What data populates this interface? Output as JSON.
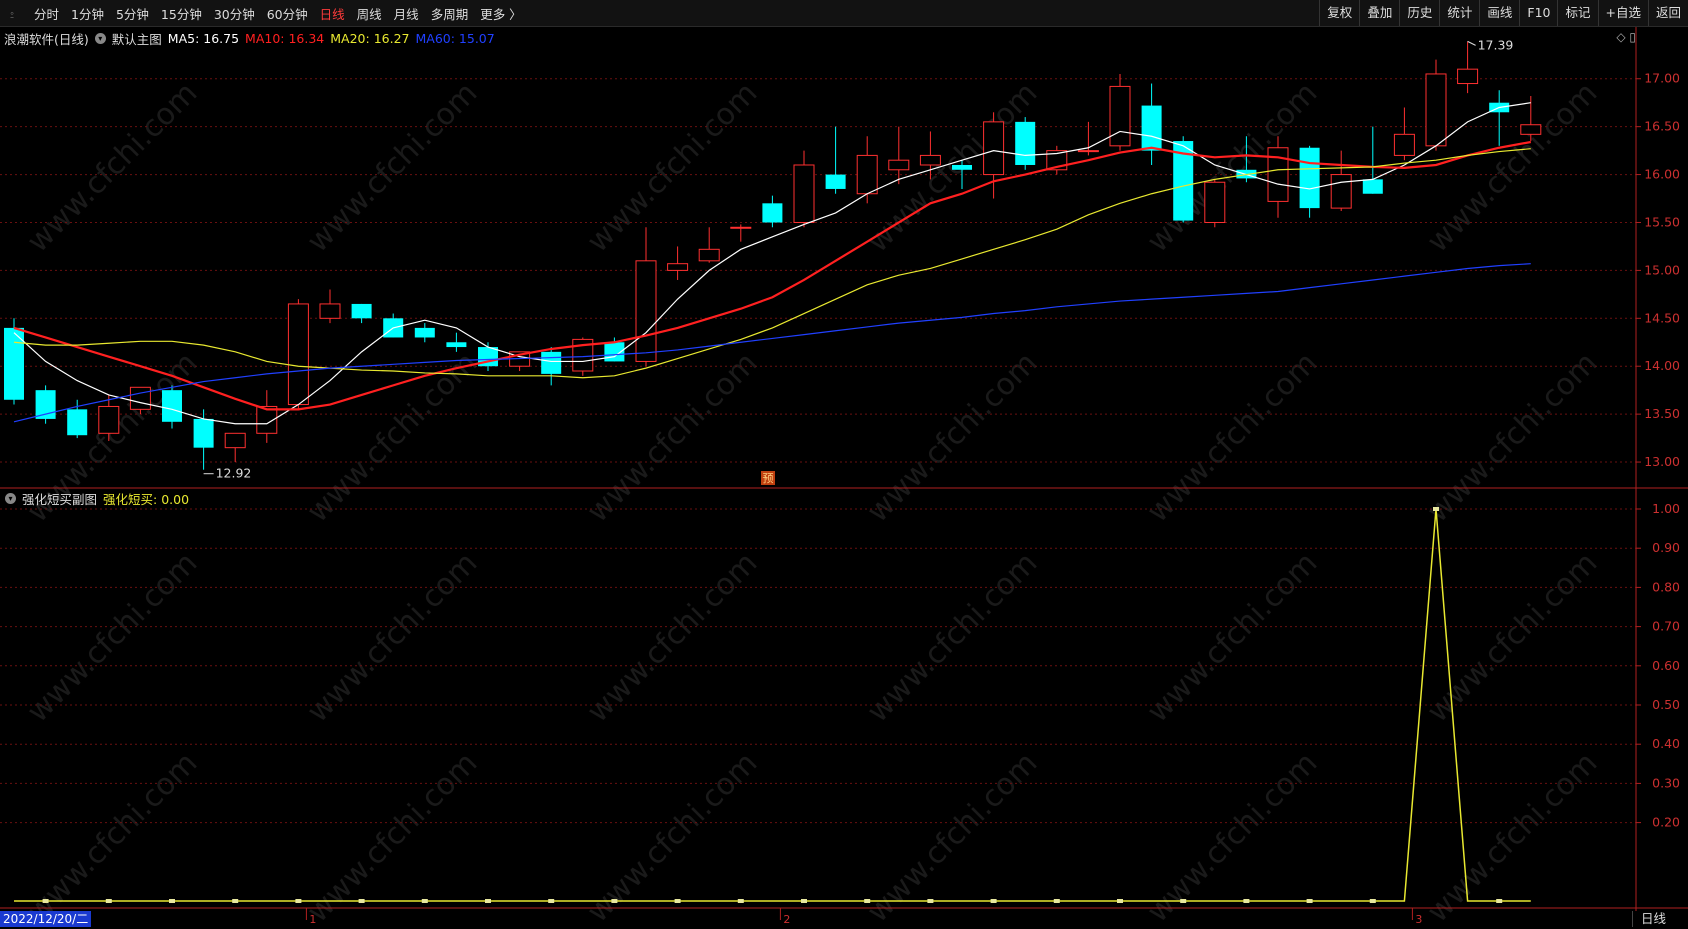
{
  "toolbar": {
    "left_icon": "⍛",
    "periods": [
      "分时",
      "1分钟",
      "5分钟",
      "15分钟",
      "30分钟",
      "60分钟",
      "日线",
      "周线",
      "月线",
      "多周期",
      "更多 〉"
    ],
    "active_period": "日线",
    "right_tools": [
      "复权",
      "叠加",
      "历史",
      "统计",
      "画线",
      "F10",
      "标记",
      "+自选",
      "返回"
    ]
  },
  "main_info": {
    "stock": "浪潮软件(日线)",
    "template": "默认主图",
    "ma5": "MA5: 16.75",
    "ma10": "MA10: 16.34",
    "ma20": "MA20: 16.27",
    "ma60": "MA60: 15.07",
    "ma5_color": "#ffffff",
    "ma10_color": "#ff2020",
    "ma20_color": "#e8e830",
    "ma60_color": "#2040ff"
  },
  "sub_info": {
    "title": "强化短买副图",
    "value": "强化短买: 0.00"
  },
  "markers": {
    "high": "17.39",
    "low": "12.92",
    "yu": "预"
  },
  "status": {
    "date": "2022/12/20/二",
    "mode": "日线",
    "month_ticks": [
      "1",
      "2",
      "3"
    ]
  },
  "watermark": "www.cfchi.com",
  "chart_data": [
    {
      "type": "candlestick",
      "title": "浪潮软件(日线)",
      "yticks": [
        13.0,
        13.5,
        14.0,
        14.5,
        15.0,
        15.5,
        16.0,
        16.5,
        17.0
      ],
      "ylim": [
        12.75,
        17.3
      ],
      "up_color": "#ff3030",
      "down_color": "#00ffff",
      "candles": [
        {
          "o": 14.4,
          "h": 14.5,
          "l": 13.6,
          "c": 13.65
        },
        {
          "o": 13.75,
          "h": 13.8,
          "l": 13.4,
          "c": 13.45
        },
        {
          "o": 13.55,
          "h": 13.65,
          "l": 13.25,
          "c": 13.28
        },
        {
          "o": 13.3,
          "h": 13.7,
          "l": 13.22,
          "c": 13.58
        },
        {
          "o": 13.55,
          "h": 13.78,
          "l": 13.5,
          "c": 13.78
        },
        {
          "o": 13.75,
          "h": 13.8,
          "l": 13.35,
          "c": 13.42
        },
        {
          "o": 13.45,
          "h": 13.55,
          "l": 12.92,
          "c": 13.15
        },
        {
          "o": 13.15,
          "h": 13.3,
          "l": 13.0,
          "c": 13.3
        },
        {
          "o": 13.3,
          "h": 13.75,
          "l": 13.2,
          "c": 13.58
        },
        {
          "o": 13.6,
          "h": 14.7,
          "l": 13.55,
          "c": 14.65
        },
        {
          "o": 14.5,
          "h": 14.8,
          "l": 14.45,
          "c": 14.65
        },
        {
          "o": 14.65,
          "h": 14.65,
          "l": 14.45,
          "c": 14.5
        },
        {
          "o": 14.5,
          "h": 14.55,
          "l": 14.3,
          "c": 14.3
        },
        {
          "o": 14.4,
          "h": 14.45,
          "l": 14.25,
          "c": 14.3
        },
        {
          "o": 14.25,
          "h": 14.35,
          "l": 14.15,
          "c": 14.2
        },
        {
          "o": 14.2,
          "h": 14.25,
          "l": 13.95,
          "c": 14.0
        },
        {
          "o": 14.0,
          "h": 14.1,
          "l": 13.95,
          "c": 14.15
        },
        {
          "o": 14.15,
          "h": 14.2,
          "l": 13.8,
          "c": 13.92
        },
        {
          "o": 13.95,
          "h": 14.3,
          "l": 13.9,
          "c": 14.28
        },
        {
          "o": 14.25,
          "h": 14.3,
          "l": 14.05,
          "c": 14.05
        },
        {
          "o": 14.05,
          "h": 15.45,
          "l": 14.0,
          "c": 15.1
        },
        {
          "o": 15.0,
          "h": 15.25,
          "l": 14.9,
          "c": 15.07
        },
        {
          "o": 15.1,
          "h": 15.45,
          "l": 15.08,
          "c": 15.22
        },
        {
          "o": 15.45,
          "h": 15.48,
          "l": 15.3,
          "c": 15.45
        },
        {
          "o": 15.7,
          "h": 15.78,
          "l": 15.45,
          "c": 15.5
        },
        {
          "o": 15.5,
          "h": 16.25,
          "l": 15.45,
          "c": 16.1
        },
        {
          "o": 16.0,
          "h": 16.5,
          "l": 15.8,
          "c": 15.85
        },
        {
          "o": 15.8,
          "h": 16.4,
          "l": 15.7,
          "c": 16.2
        },
        {
          "o": 16.05,
          "h": 16.5,
          "l": 15.9,
          "c": 16.15
        },
        {
          "o": 16.1,
          "h": 16.45,
          "l": 15.95,
          "c": 16.2
        },
        {
          "o": 16.1,
          "h": 16.15,
          "l": 15.85,
          "c": 16.05
        },
        {
          "o": 16.0,
          "h": 16.65,
          "l": 15.75,
          "c": 16.55
        },
        {
          "o": 16.55,
          "h": 16.6,
          "l": 16.05,
          "c": 16.1
        },
        {
          "o": 16.05,
          "h": 16.3,
          "l": 16.0,
          "c": 16.25
        },
        {
          "o": 16.25,
          "h": 16.55,
          "l": 16.2,
          "c": 16.25
        },
        {
          "o": 16.3,
          "h": 17.05,
          "l": 16.25,
          "c": 16.92
        },
        {
          "o": 16.72,
          "h": 16.95,
          "l": 16.1,
          "c": 16.25
        },
        {
          "o": 16.35,
          "h": 16.4,
          "l": 15.5,
          "c": 15.52
        },
        {
          "o": 15.5,
          "h": 15.95,
          "l": 15.45,
          "c": 15.92
        },
        {
          "o": 16.05,
          "h": 16.4,
          "l": 15.92,
          "c": 15.96
        },
        {
          "o": 15.72,
          "h": 16.4,
          "l": 15.55,
          "c": 16.28
        },
        {
          "o": 16.28,
          "h": 16.3,
          "l": 15.55,
          "c": 15.65
        },
        {
          "o": 15.65,
          "h": 16.25,
          "l": 15.62,
          "c": 16.0
        },
        {
          "o": 15.95,
          "h": 16.5,
          "l": 15.8,
          "c": 15.8
        },
        {
          "o": 16.2,
          "h": 16.7,
          "l": 16.15,
          "c": 16.42
        },
        {
          "o": 16.3,
          "h": 17.2,
          "l": 16.25,
          "c": 17.05
        },
        {
          "o": 16.95,
          "h": 17.39,
          "l": 16.85,
          "c": 17.1
        },
        {
          "o": 16.75,
          "h": 16.88,
          "l": 16.3,
          "c": 16.65
        },
        {
          "o": 16.42,
          "h": 16.82,
          "l": 16.35,
          "c": 16.52
        }
      ],
      "series": [
        {
          "name": "MA5",
          "color": "#ffffff",
          "values": [
            14.35,
            14.05,
            13.85,
            13.7,
            13.62,
            13.55,
            13.45,
            13.4,
            13.4,
            13.6,
            13.85,
            14.15,
            14.4,
            14.48,
            14.4,
            14.2,
            14.1,
            14.05,
            14.05,
            14.1,
            14.35,
            14.7,
            15.0,
            15.22,
            15.35,
            15.48,
            15.6,
            15.8,
            15.95,
            16.05,
            16.15,
            16.25,
            16.2,
            16.22,
            16.28,
            16.45,
            16.4,
            16.3,
            16.1,
            16.0,
            15.9,
            15.85,
            15.92,
            15.95,
            16.1,
            16.3,
            16.55,
            16.7,
            16.75
          ]
        },
        {
          "name": "MA10",
          "color": "#ff2020",
          "values": [
            14.4,
            14.3,
            14.2,
            14.1,
            14.0,
            13.9,
            13.78,
            13.66,
            13.55,
            13.55,
            13.6,
            13.7,
            13.8,
            13.9,
            13.98,
            14.05,
            14.12,
            14.18,
            14.22,
            14.25,
            14.32,
            14.4,
            14.5,
            14.6,
            14.72,
            14.9,
            15.1,
            15.3,
            15.5,
            15.7,
            15.8,
            15.93,
            16.0,
            16.08,
            16.15,
            16.23,
            16.28,
            16.22,
            16.18,
            16.2,
            16.18,
            16.12,
            16.1,
            16.08,
            16.07,
            16.1,
            16.2,
            16.28,
            16.34
          ]
        },
        {
          "name": "MA20",
          "color": "#e8e830",
          "values": [
            14.25,
            14.22,
            14.22,
            14.24,
            14.26,
            14.26,
            14.22,
            14.15,
            14.05,
            14.0,
            13.98,
            13.96,
            13.95,
            13.93,
            13.92,
            13.9,
            13.9,
            13.9,
            13.88,
            13.9,
            13.98,
            14.08,
            14.18,
            14.28,
            14.4,
            14.55,
            14.7,
            14.85,
            14.95,
            15.02,
            15.12,
            15.22,
            15.32,
            15.43,
            15.58,
            15.7,
            15.8,
            15.88,
            15.95,
            16.0,
            16.05,
            16.06,
            16.07,
            16.08,
            16.12,
            16.15,
            16.2,
            16.24,
            16.27
          ]
        },
        {
          "name": "MA60",
          "color": "#2040ff",
          "values": [
            13.42,
            13.5,
            13.58,
            13.65,
            13.72,
            13.78,
            13.84,
            13.88,
            13.92,
            13.95,
            13.98,
            14.0,
            14.02,
            14.04,
            14.06,
            14.07,
            14.08,
            14.09,
            14.1,
            14.12,
            14.14,
            14.17,
            14.21,
            14.25,
            14.29,
            14.33,
            14.37,
            14.41,
            14.45,
            14.48,
            14.51,
            14.55,
            14.58,
            14.62,
            14.65,
            14.68,
            14.7,
            14.72,
            14.74,
            14.76,
            14.78,
            14.82,
            14.86,
            14.9,
            14.94,
            14.98,
            15.02,
            15.05,
            15.07
          ]
        }
      ]
    },
    {
      "type": "line",
      "title": "强化短买副图",
      "yticks": [
        0.2,
        0.3,
        0.4,
        0.5,
        0.6,
        0.7,
        0.8,
        0.9,
        1.0
      ],
      "ylim": [
        0,
        1.0
      ],
      "series": [
        {
          "name": "强化短买",
          "color": "#e8e830",
          "values": [
            0,
            0,
            0,
            0,
            0,
            0,
            0,
            0,
            0,
            0,
            0,
            0,
            0,
            0,
            0,
            0,
            0,
            0,
            0,
            0,
            0,
            0,
            0,
            0,
            0,
            0,
            0,
            0,
            0,
            0,
            0,
            0,
            0,
            0,
            0,
            0,
            0,
            0,
            0,
            0,
            0,
            0,
            0,
            0,
            0,
            1,
            0,
            0,
            0
          ]
        }
      ]
    }
  ]
}
